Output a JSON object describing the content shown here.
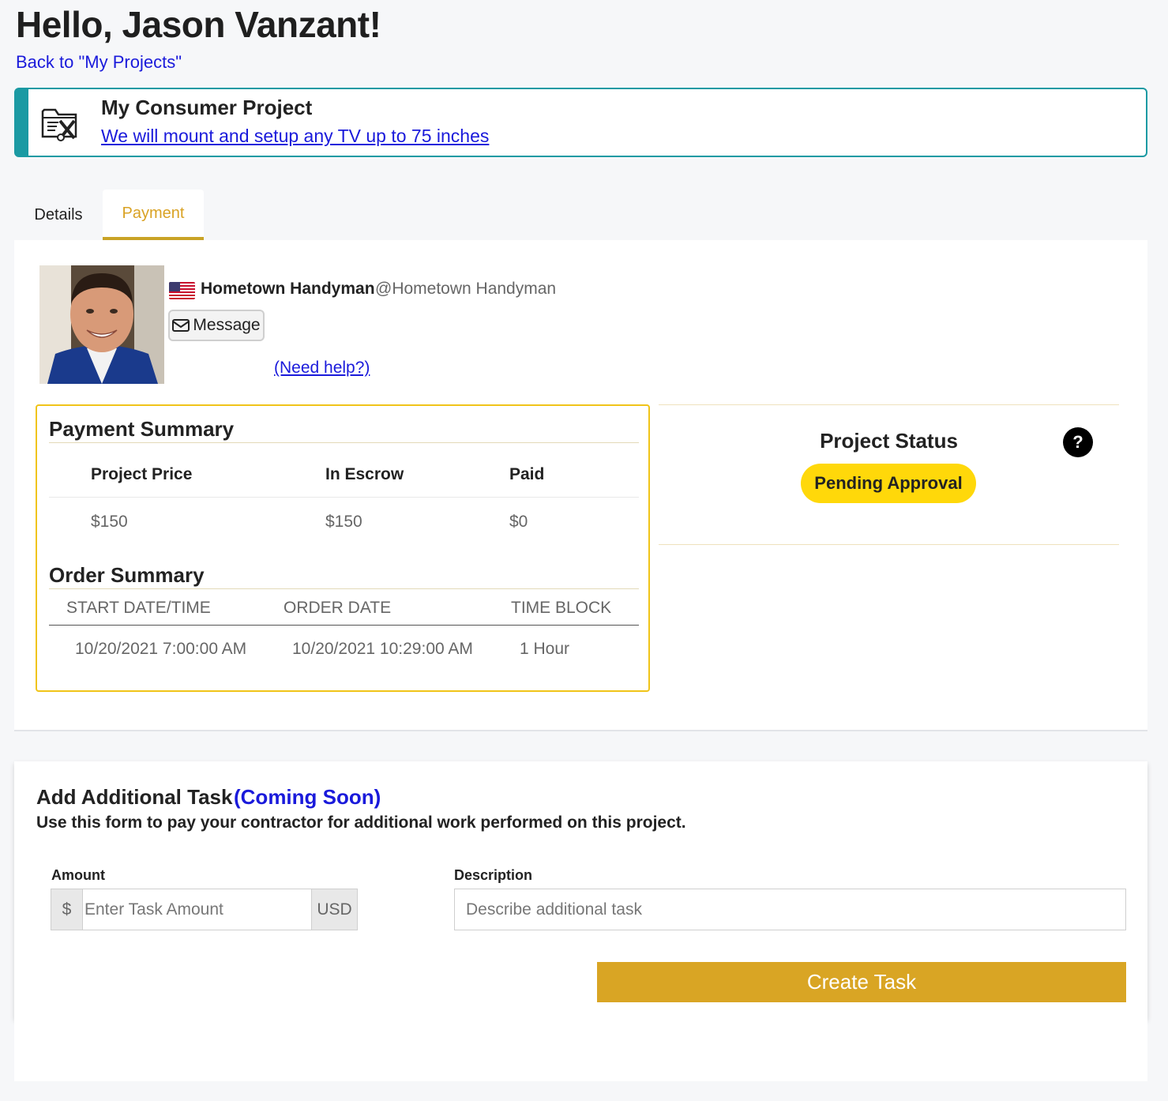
{
  "header": {
    "greeting": "Hello, Jason Vanzant!",
    "back_link": "Back to \"My Projects\""
  },
  "project": {
    "icon": "tools-folder-icon",
    "title": "My Consumer Project",
    "subtitle": "We will mount and setup any TV up to 75 inches",
    "accent_color": "#1b9aa3"
  },
  "tabs": [
    {
      "label": "Details",
      "active": false
    },
    {
      "label": "Payment",
      "active": true
    }
  ],
  "provider": {
    "name": "Hometown Handyman",
    "handle": "@Hometown Handyman",
    "flag": "us-flag-icon",
    "message_label": "Message",
    "need_help": "(Need help?)"
  },
  "payment_summary": {
    "title": "Payment Summary",
    "headers": [
      "Project Price",
      "In Escrow",
      "Paid"
    ],
    "values": [
      "$150",
      "$150",
      "$0"
    ]
  },
  "order_summary": {
    "title": "Order Summary",
    "headers": [
      "START DATE/TIME",
      "ORDER DATE",
      "TIME BLOCK"
    ],
    "values": [
      "10/20/2021 7:00:00 AM",
      "10/20/2021 10:29:00 AM",
      "1 Hour"
    ]
  },
  "status": {
    "title": "Project Status",
    "help": "?",
    "badge": "Pending Approval",
    "badge_color": "#ffd80a"
  },
  "additional_task": {
    "title": "Add Additional Task",
    "coming_soon": "(Coming Soon)",
    "description": "Use this form to pay your contractor for additional work performed on this project.",
    "amount_label": "Amount",
    "amount_prefix": "$",
    "amount_placeholder": "Enter Task Amount",
    "amount_suffix": "USD",
    "description_label": "Description",
    "description_placeholder": "Describe additional task",
    "create_button": "Create Task",
    "button_color": "#d9a524"
  }
}
